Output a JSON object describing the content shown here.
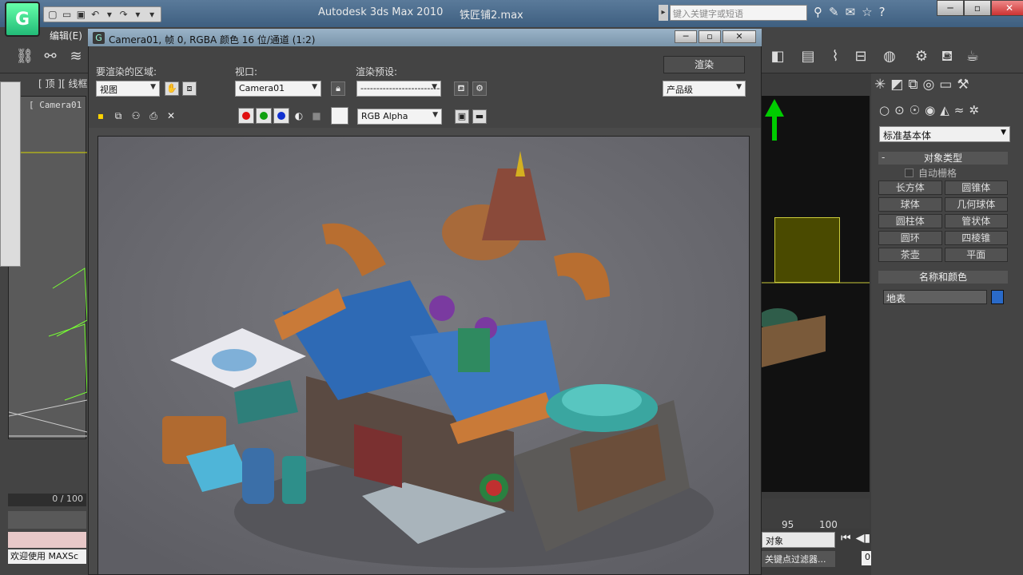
{
  "app": {
    "title": "Autodesk 3ds Max  2010",
    "file": "铁匠铺2.max",
    "logo": "3ds-max-logo-icon"
  },
  "search": {
    "placeholder": "键入关键字或短语"
  },
  "menu": {
    "edit": "编辑(E)"
  },
  "left_viewport": {
    "label": "[ 顶 ][ 线框",
    "camera": "[ Camera01",
    "timeline": "0 / 100",
    "status": "欢迎使用 MAXSc"
  },
  "render_frame": {
    "title": "Camera01, 帧 0, RGBA 颜色 16 位/通道 (1:2)",
    "area_label": "要渲染的区域:",
    "area_value": "视图",
    "viewport_label": "视口:",
    "viewport_value": "Camera01",
    "preset_label": "渲染预设:",
    "preset_value": "----------------------------",
    "render_button": "渲染",
    "quality_value": "产品级",
    "channel_value": "RGB Alpha",
    "channel_colors": [
      "#e01010",
      "#10a010",
      "#1030d0"
    ]
  },
  "timeline_right": {
    "ruler": [
      "95",
      "100"
    ],
    "selection": "对象",
    "key_filter": "关键点过滤器...",
    "frame": "0"
  },
  "command_panel": {
    "category": "标准基本体",
    "object_type_title": "对象类型",
    "autogrid": "自动栅格",
    "objects": [
      "长方体",
      "圆锥体",
      "球体",
      "几何球体",
      "圆柱体",
      "管状体",
      "圆环",
      "四棱锥",
      "茶壶",
      "平面"
    ],
    "name_color_title": "名称和颜色",
    "name_value": "地表",
    "object_color": "#2a6ac8"
  }
}
